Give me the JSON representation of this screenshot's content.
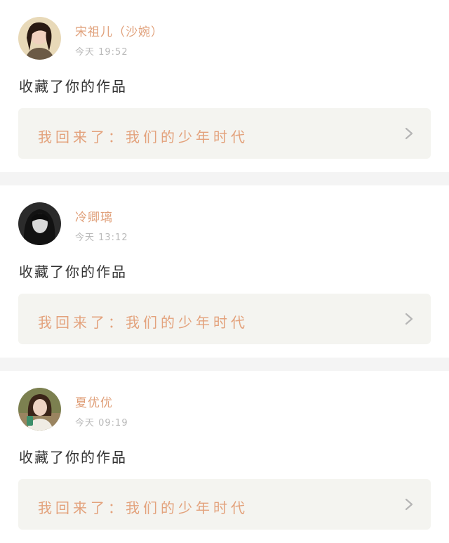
{
  "notifications": [
    {
      "username": "宋祖儿（沙婉）",
      "time": "今天 19:52",
      "action": "收藏了你的作品",
      "work_title": "我回来了：我们的少年时代",
      "avatar_icon": "avatar-woman-light-bg"
    },
    {
      "username": "冷卿璃",
      "time": "今天 13:12",
      "action": "收藏了你的作品",
      "work_title": "我回来了：我们的少年时代",
      "avatar_icon": "avatar-bw-portrait"
    },
    {
      "username": "夏优优",
      "time": "今天 09:19",
      "action": "收藏了你的作品",
      "work_title": "我回来了：我们的少年时代",
      "avatar_icon": "avatar-woman-outdoor"
    }
  ],
  "colors": {
    "username": "#e0a07a",
    "work_title": "#e3a27c",
    "time": "#b9b9b9",
    "card_link_bg": "#f4f4f0",
    "separator": "#f4f4f4"
  }
}
